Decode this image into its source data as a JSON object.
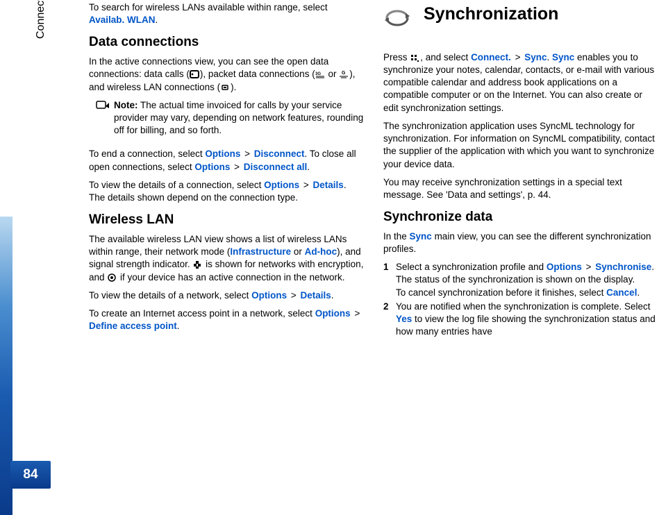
{
  "sidebar": {
    "section_label": "Connectivity",
    "page_number": "84"
  },
  "left": {
    "intro": {
      "pre": "To search for wireless LANs available within range, select ",
      "link": "Availab. WLAN",
      "post": "."
    },
    "h_data_connections": "Data connections",
    "data_conn_para": {
      "p1": "In the active connections view, you can see the open data connections: data calls (",
      "p2": "), packet data connections (",
      "p3": " or ",
      "p4": "), and wireless LAN connections (",
      "p5": ")."
    },
    "note": {
      "label": "Note:",
      "text": " The actual time invoiced for calls by your service provider may vary, depending on network features, rounding off for billing, and so forth."
    },
    "end_conn": {
      "p1": "To end a connection, select ",
      "opt1": "Options",
      "gt1": " > ",
      "disc": "Disconnect",
      "p2": ". To close all open connections, select ",
      "opt2": "Options",
      "gt2": " > ",
      "discall": "Disconnect all",
      "p3": "."
    },
    "view_details": {
      "p1": "To view the details of a connection, select ",
      "opt": "Options",
      "gt": " > ",
      "det": "Details",
      "p2": ". The details shown depend on the connection type."
    },
    "h_wireless": "Wireless LAN",
    "wlan_list": {
      "p1": "The available wireless LAN view shows a list of wireless LANs within range, their network mode (",
      "infra": "Infrastructure",
      "or": " or ",
      "adhoc": "Ad-hoc",
      "p2": "), and signal strength indicator. ",
      "p3": " is shown for networks with encryption, and ",
      "p4": " if your device has an active connection in the network."
    },
    "wlan_details": {
      "p1": "To view the details of a network, select ",
      "opt": "Options",
      "gt": " > ",
      "det": "Details",
      "p2": "."
    },
    "wlan_create": {
      "p1": "To create an Internet access point in a network, select ",
      "opt": "Options",
      "gt": " > ",
      "def": "Define access point",
      "p2": "."
    }
  },
  "right": {
    "h_sync": "Synchronization",
    "press": {
      "p1": "Press ",
      "p2": ", and select ",
      "connect": "Connect.",
      "gt": " > ",
      "sync1": "Sync",
      "dot": ". ",
      "sync2": "Sync",
      "p3": " enables you to synchronize your notes, calendar, contacts, or e-mail with various compatible calendar and address book applications on a compatible computer or on the Internet. You can also create or edit synchronization settings."
    },
    "syncml": "The synchronization application uses SyncML technology for synchronization. For information on SyncML compatibility, contact the supplier of the application with which you want to synchronize your device data.",
    "special_msg": "You may receive synchronization settings in a special text message. See 'Data and settings', p. 44.",
    "h_syncdata": "Synchronize data",
    "syncdata_intro": {
      "p1": "In the ",
      "sync": "Sync",
      "p2": " main view, you can see the different synchronization profiles."
    },
    "steps": {
      "s1": {
        "num": "1",
        "p1": "Select a synchronization profile and ",
        "opt": "Options",
        "gt": " > ",
        "syncr": "Synchronise",
        "p2": ". The status of the synchronization is shown on the display.",
        "p3": "To cancel synchronization before it finishes, select ",
        "cancel": "Cancel",
        "p4": "."
      },
      "s2": {
        "num": "2",
        "p1": "You are notified when the synchronization is complete. Select ",
        "yes": "Yes",
        "p2": " to view the log file showing the synchronization status and how many entries have"
      }
    }
  }
}
